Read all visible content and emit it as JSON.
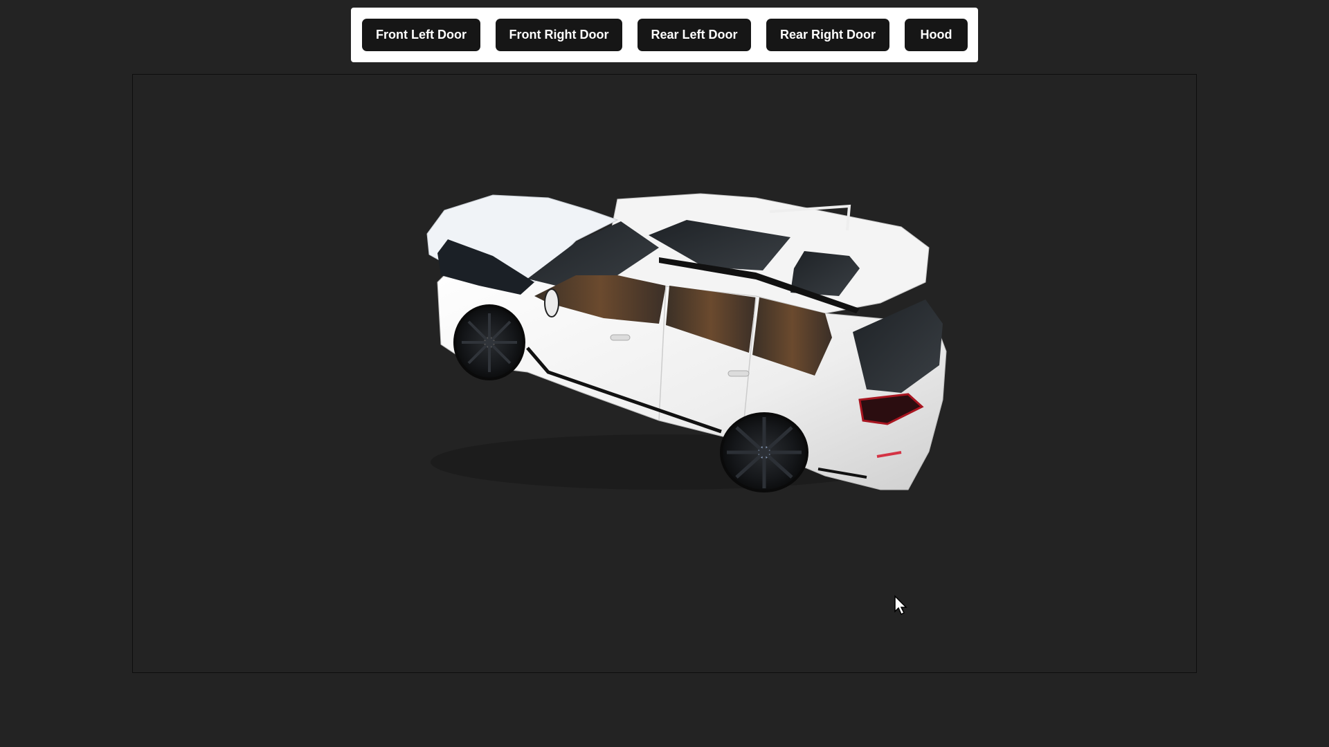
{
  "toolbar": {
    "buttons": [
      {
        "label": "Front Left Door"
      },
      {
        "label": "Front Right Door"
      },
      {
        "label": "Rear Left Door"
      },
      {
        "label": "Rear Right Door"
      },
      {
        "label": "Hood"
      }
    ]
  },
  "viewer": {
    "model_icon": "suv-3d-model",
    "state": {
      "hood": "open",
      "front_left_door": "closed",
      "front_right_door": "closed",
      "rear_left_door": "closed",
      "rear_right_door": "closed"
    }
  },
  "colors": {
    "page_background": "#232323",
    "toolbar_background": "#ffffff",
    "button_background": "#161616",
    "button_text": "#ffffff",
    "car_body": "#f2f2f2"
  }
}
